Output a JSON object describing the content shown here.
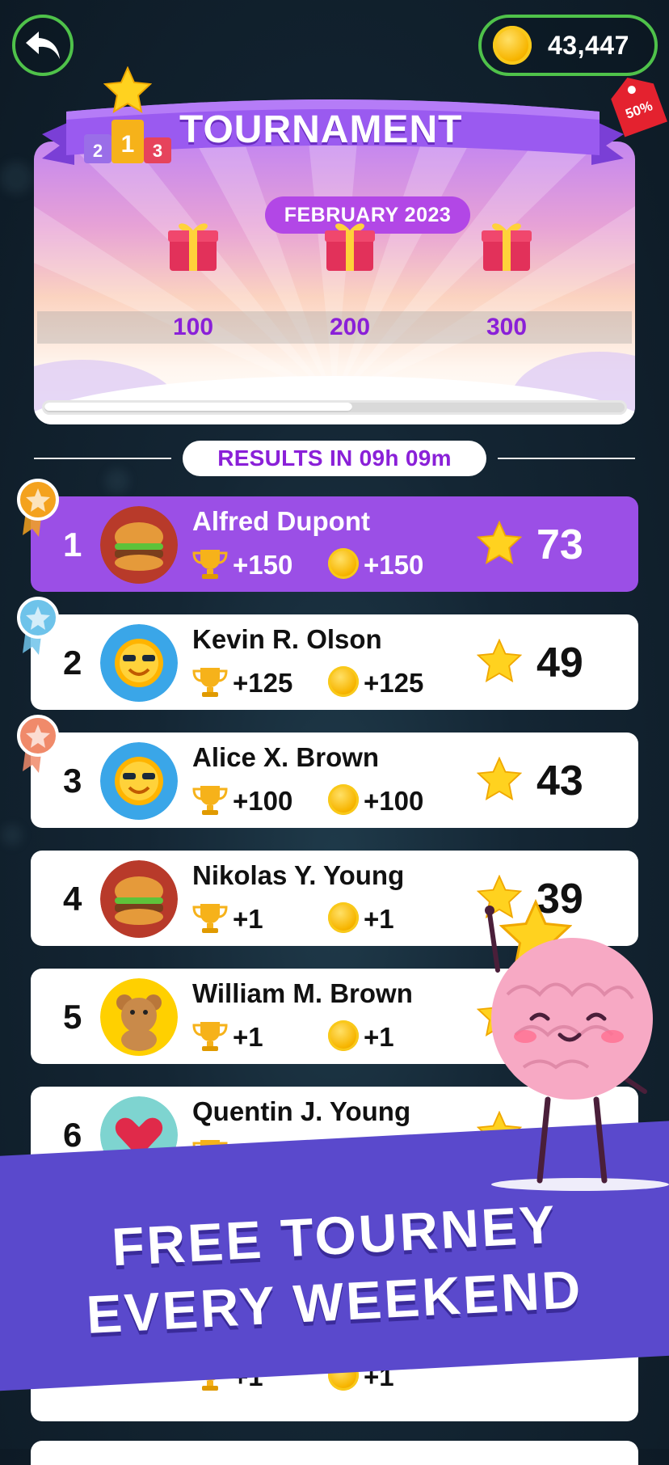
{
  "header": {
    "coins": "43,447",
    "sale_badge": "50%"
  },
  "tournament": {
    "title": "TOURNAMENT",
    "podium": [
      "2",
      "1",
      "3"
    ],
    "month": "FEBRUARY 2023",
    "rewards": [
      "100",
      "200",
      "300"
    ],
    "progress": 0.53,
    "results_label": "RESULTS IN 09h 09m"
  },
  "leaderboard": [
    {
      "rank": "1",
      "name": "Alfred Dupont",
      "trophy_reward": "+150",
      "coin_reward": "+150",
      "score": "73",
      "avatar": "burger-avatar",
      "medal": "gold"
    },
    {
      "rank": "2",
      "name": "Kevin R. Olson",
      "trophy_reward": "+125",
      "coin_reward": "+125",
      "score": "49",
      "avatar": "sun-avatar",
      "medal": "silver"
    },
    {
      "rank": "3",
      "name": "Alice X. Brown",
      "trophy_reward": "+100",
      "coin_reward": "+100",
      "score": "43",
      "avatar": "sun-avatar",
      "medal": "bronze"
    },
    {
      "rank": "4",
      "name": "Nikolas Y. Young",
      "trophy_reward": "+1",
      "coin_reward": "+1",
      "score": "39",
      "avatar": "burger-avatar"
    },
    {
      "rank": "5",
      "name": "William M. Brown",
      "trophy_reward": "+1",
      "coin_reward": "+1",
      "score": "",
      "avatar": "teddy-avatar"
    },
    {
      "rank": "6",
      "name": "Quentin J. Young",
      "trophy_reward": "",
      "coin_reward": "",
      "score": "",
      "avatar": "heart-avatar"
    }
  ],
  "peek_row": {
    "trophy_reward": "+1",
    "coin_reward": "+1"
  },
  "promo": {
    "line1": "FREE TOURNEY",
    "line2": "EVERY WEEKEND"
  },
  "colors": {
    "accent": "#9b4fe6",
    "green_border": "#4fc24a",
    "reward_text": "#8a20d8",
    "banner": "#5a49cc"
  }
}
